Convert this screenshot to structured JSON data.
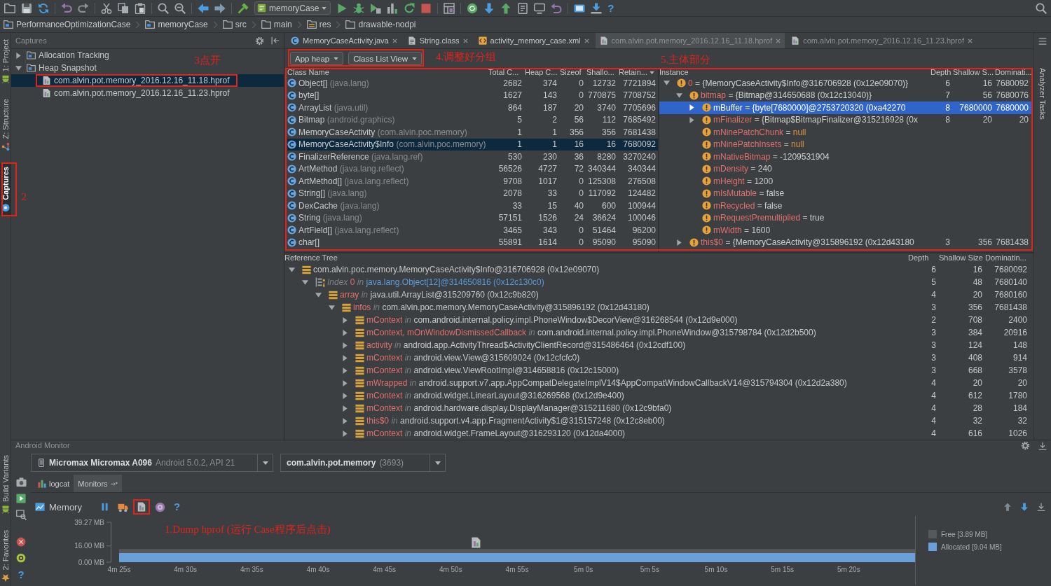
{
  "toolbar": {
    "run_configuration": "memoryCase",
    "help": "?"
  },
  "breadcrumbs": [
    {
      "label": "PerformanceOptimizationCase",
      "kind": "module"
    },
    {
      "label": "memoryCase",
      "kind": "module"
    },
    {
      "label": "src",
      "kind": "folder"
    },
    {
      "label": "main",
      "kind": "folder"
    },
    {
      "label": "res",
      "kind": "resources"
    },
    {
      "label": "drawable-nodpi",
      "kind": "folder"
    }
  ],
  "left_toolstrip": {
    "top": [
      {
        "label": "1: Project",
        "selected": false
      },
      {
        "label": "Z: Structure",
        "selected": false
      },
      {
        "label": "Captures",
        "selected": true,
        "callout": "2"
      }
    ],
    "bottom": [
      {
        "label": "Build Variants",
        "selected": false
      },
      {
        "label": "2: Favorites",
        "selected": false
      }
    ]
  },
  "right_toolstrip": [
    {
      "label": "Analyzer Tasks",
      "selected": false
    }
  ],
  "captures": {
    "title": "Captures",
    "tree": [
      {
        "label": "Allocation Tracking",
        "kind": "folder",
        "expanded": false,
        "selected": false
      },
      {
        "label": "Heap Snapshot",
        "kind": "folder",
        "expanded": true,
        "selected": false,
        "children": [
          {
            "label": "com.alvin.pot.memory_2016.12.16_11.18.hprof",
            "kind": "hprof",
            "selected": true,
            "callout": "3点开"
          },
          {
            "label": "com.alvin.pot.memory_2016.12.16_11.23.hprof",
            "kind": "hprof",
            "selected": false
          }
        ]
      }
    ]
  },
  "editor_tabs": [
    {
      "label": "MemoryCaseActivity.java",
      "kind": "class",
      "selected": false,
      "dimmed": false
    },
    {
      "label": "String.class",
      "kind": "classfile",
      "selected": false,
      "dimmed": false
    },
    {
      "label": "activity_memory_case.xml",
      "kind": "xml",
      "selected": false,
      "dimmed": false
    },
    {
      "label": "com.alvin.pot.memory_2016.12.16_11.18.hprof",
      "kind": "hprof",
      "selected": true,
      "dimmed": true
    },
    {
      "label": "com.alvin.pot.memory_2016.12.16_11.23.hprof",
      "kind": "hprof",
      "selected": false,
      "dimmed": true
    }
  ],
  "heap_view": {
    "heap": "App heap",
    "view": "Class List View",
    "callout": "4.调整好分组",
    "tables_callout": "5.主体部分",
    "class_table": {
      "columns": [
        {
          "label": "Class Name",
          "sorted": false
        },
        {
          "label": "Total C...",
          "sorted": false
        },
        {
          "label": "Heap C...",
          "sorted": false
        },
        {
          "label": "Sizeof",
          "sorted": false
        },
        {
          "label": "Shallo...",
          "sorted": false
        },
        {
          "label": "Retain...",
          "sorted": true
        }
      ],
      "rows": [
        {
          "name": "Object[]",
          "package": "(java.lang)",
          "total": "2682",
          "heap": "374",
          "sizeof": "0",
          "shallow": "12732",
          "retained": "7721894",
          "selected": false
        },
        {
          "name": "byte[]",
          "total": "1627",
          "heap": "143",
          "sizeof": "0",
          "shallow": "770875",
          "retained": "7708752",
          "selected": false
        },
        {
          "name": "ArrayList",
          "package": "(java.util)",
          "total": "864",
          "heap": "187",
          "sizeof": "20",
          "shallow": "3740",
          "retained": "7705696",
          "selected": false
        },
        {
          "name": "Bitmap",
          "package": "(android.graphics)",
          "total": "5",
          "heap": "2",
          "sizeof": "56",
          "shallow": "112",
          "retained": "7685492",
          "selected": false
        },
        {
          "name": "MemoryCaseActivity",
          "package": "(com.alvin.poc.memory)",
          "total": "1",
          "heap": "1",
          "sizeof": "356",
          "shallow": "356",
          "retained": "7681438",
          "selected": false
        },
        {
          "name": "MemoryCaseActivity$Info",
          "package": "(com.alvin.poc.memory)",
          "total": "1",
          "heap": "1",
          "sizeof": "16",
          "shallow": "16",
          "retained": "7680092",
          "selected": true
        },
        {
          "name": "FinalizerReference",
          "package": "(java.lang.ref)",
          "total": "530",
          "heap": "230",
          "sizeof": "36",
          "shallow": "8280",
          "retained": "3270240",
          "selected": false
        },
        {
          "name": "ArtMethod",
          "package": "(java.lang.reflect)",
          "total": "56526",
          "heap": "4727",
          "sizeof": "72",
          "shallow": "340344",
          "retained": "340344",
          "selected": false
        },
        {
          "name": "ArtMethod[]",
          "package": "(java.lang.reflect)",
          "total": "9708",
          "heap": "1017",
          "sizeof": "0",
          "shallow": "125308",
          "retained": "276508",
          "selected": false
        },
        {
          "name": "String[]",
          "package": "(java.lang)",
          "total": "2078",
          "heap": "33",
          "sizeof": "0",
          "shallow": "117092",
          "retained": "124482",
          "selected": false
        },
        {
          "name": "DexCache",
          "package": "(java.lang)",
          "total": "33",
          "heap": "15",
          "sizeof": "40",
          "shallow": "600",
          "retained": "100944",
          "selected": false
        },
        {
          "name": "String",
          "package": "(java.lang)",
          "total": "57151",
          "heap": "1526",
          "sizeof": "24",
          "shallow": "36624",
          "retained": "100046",
          "selected": false
        },
        {
          "name": "ArtField[]",
          "package": "(java.lang.reflect)",
          "total": "3465",
          "heap": "343",
          "sizeof": "0",
          "shallow": "51464",
          "retained": "96200",
          "selected": false
        },
        {
          "name": "char[]",
          "total": "55891",
          "heap": "1614",
          "sizeof": "0",
          "shallow": "95090",
          "retained": "95090",
          "selected": false
        }
      ]
    },
    "instances": {
      "columns": [
        "Instance",
        "Depth",
        "Shallow S...",
        "Dominati..."
      ],
      "tree": [
        {
          "name": "0",
          "assign": "=",
          "value": "{MemoryCaseActivity$Info@316706928 (0x12e09070)}",
          "kind": "value",
          "depth": "6",
          "shallow": "16",
          "dominating": "7680092",
          "expanded": true,
          "selected": false,
          "children": [
            {
              "name": "bitmap",
              "assign": "=",
              "value": "{Bitmap@314650688 (0x12c13040)}",
              "kind": "value",
              "depth": "7",
              "shallow": "56",
              "dominating": "7680076",
              "expanded": true,
              "selected": false,
              "children": [
                {
                  "name": "mBuffer",
                  "assign": "=",
                  "value": "{byte[7680000]@2753720320 (0xa42270",
                  "kind": "value",
                  "depth": "8",
                  "shallow": "7680000",
                  "dominating": "7680000",
                  "expanded": false,
                  "selected": true
                },
                {
                  "name": "mFinalizer",
                  "assign": "=",
                  "value": "{Bitmap$BitmapFinalizer@315216928 (0x",
                  "kind": "value",
                  "depth": "8",
                  "shallow": "20",
                  "dominating": "20",
                  "expanded": false,
                  "selected": false
                },
                {
                  "name": "mNinePatchChunk",
                  "assign": "=",
                  "value": "null",
                  "kind": "null",
                  "selected": false
                },
                {
                  "name": "mNinePatchInsets",
                  "assign": "=",
                  "value": "null",
                  "kind": "null",
                  "selected": false
                },
                {
                  "name": "mNativeBitmap",
                  "assign": "=",
                  "value": "-1209531904",
                  "kind": "value",
                  "selected": false
                },
                {
                  "name": "mDensity",
                  "assign": "=",
                  "value": "240",
                  "kind": "value",
                  "selected": false
                },
                {
                  "name": "mHeight",
                  "assign": "=",
                  "value": "1200",
                  "kind": "value",
                  "selected": false
                },
                {
                  "name": "mIsMutable",
                  "assign": "=",
                  "value": "false",
                  "kind": "value",
                  "selected": false
                },
                {
                  "name": "mRecycled",
                  "assign": "=",
                  "value": "false",
                  "kind": "value",
                  "selected": false
                },
                {
                  "name": "mRequestPremultiplied",
                  "assign": "=",
                  "value": "true",
                  "kind": "value",
                  "selected": false
                },
                {
                  "name": "mWidth",
                  "assign": "=",
                  "value": "1600",
                  "kind": "value",
                  "selected": false
                }
              ]
            },
            {
              "name": "this$0",
              "assign": "=",
              "value": "{MemoryCaseActivity@315896192 (0x12d43180",
              "kind": "value",
              "depth": "3",
              "shallow": "356",
              "dominating": "7681438",
              "expanded": false,
              "selected": false
            }
          ]
        }
      ]
    },
    "reference_tree": {
      "columns": [
        "Reference Tree",
        "Depth",
        "Shallow Size",
        "Dominatin..."
      ],
      "tree": [
        {
          "kind": "root",
          "object": "com.alvin.poc.memory.MemoryCaseActivity$Info@316706928 (0x12e09070)",
          "depth": "6",
          "shallow": "16",
          "dominating": "7680092",
          "expanded": true,
          "selected": false,
          "children": [
            {
              "kind": "index",
              "index_label": "Index",
              "field": "0",
              "relation": "in",
              "object": "java.lang.Object[12]@314650816 (0x12c130c0)",
              "depth": "5",
              "shallow": "48",
              "dominating": "7680140",
              "expanded": true,
              "selected": false,
              "children": [
                {
                  "kind": "field",
                  "field": "array",
                  "relation": "in",
                  "object": "java.util.ArrayList@315209760 (0x12c9b820)",
                  "depth": "4",
                  "shallow": "20",
                  "dominating": "7680160",
                  "expanded": true,
                  "selected": false,
                  "children": [
                    {
                      "kind": "field",
                      "field": "infos",
                      "relation": "in",
                      "object": "com.alvin.poc.memory.MemoryCaseActivity@315896192 (0x12d43180)",
                      "depth": "3",
                      "shallow": "356",
                      "dominating": "7681438",
                      "expanded": true,
                      "selected": false,
                      "children": [
                        {
                          "kind": "field",
                          "field": "mContext",
                          "relation": "in",
                          "object": "com.android.internal.policy.impl.PhoneWindow$DecorView@316268544 (0x12d9e000)",
                          "depth": "2",
                          "shallow": "708",
                          "dominating": "2400",
                          "expanded": false,
                          "selected": false
                        },
                        {
                          "kind": "field",
                          "field": "mContext, mOnWindowDismissedCallback",
                          "relation": "in",
                          "object": "com.android.internal.policy.impl.PhoneWindow@315798784 (0x12d2b500)",
                          "depth": "3",
                          "shallow": "384",
                          "dominating": "20916",
                          "expanded": false,
                          "selected": false
                        },
                        {
                          "kind": "field",
                          "field": "activity",
                          "relation": "in",
                          "object": "android.app.ActivityThread$ActivityClientRecord@315486464 (0x12cdf100)",
                          "depth": "3",
                          "shallow": "124",
                          "dominating": "148",
                          "expanded": false,
                          "selected": false
                        },
                        {
                          "kind": "field",
                          "field": "mContext",
                          "relation": "in",
                          "object": "android.view.View@315609024 (0x12cfcfc0)",
                          "depth": "3",
                          "shallow": "408",
                          "dominating": "914",
                          "expanded": false,
                          "selected": false
                        },
                        {
                          "kind": "field",
                          "field": "mContext",
                          "relation": "in",
                          "object": "android.view.ViewRootImpl@314658816 (0x12c15000)",
                          "depth": "3",
                          "shallow": "668",
                          "dominating": "3578",
                          "expanded": false,
                          "selected": false
                        },
                        {
                          "kind": "field",
                          "field": "mWrapped",
                          "relation": "in",
                          "object": "android.support.v7.app.AppCompatDelegateImplV14$AppCompatWindowCallbackV14@315794304 (0x12d2a380)",
                          "depth": "4",
                          "shallow": "20",
                          "dominating": "20",
                          "expanded": false,
                          "selected": false
                        },
                        {
                          "kind": "field",
                          "field": "mContext",
                          "relation": "in",
                          "object": "android.widget.LinearLayout@316269568 (0x12d9e400)",
                          "depth": "4",
                          "shallow": "612",
                          "dominating": "1780",
                          "expanded": false,
                          "selected": false
                        },
                        {
                          "kind": "field",
                          "field": "mContext",
                          "relation": "in",
                          "object": "android.hardware.display.DisplayManager@315211680 (0x12c9bfa0)",
                          "depth": "4",
                          "shallow": "28",
                          "dominating": "184",
                          "expanded": false,
                          "selected": false
                        },
                        {
                          "kind": "field",
                          "field": "this$0",
                          "relation": "in",
                          "object": "android.support.v4.app.FragmentActivity$1@315157248 (0x12c8eb00)",
                          "depth": "4",
                          "shallow": "32",
                          "dominating": "32",
                          "expanded": false,
                          "selected": false
                        },
                        {
                          "kind": "field",
                          "field": "mContext",
                          "relation": "in",
                          "object": "android.widget.FrameLayout@316293120 (0x12da4000)",
                          "depth": "4",
                          "shallow": "616",
                          "dominating": "1026",
                          "expanded": false,
                          "selected": false
                        }
                      ]
                    }
                  ]
                }
              ]
            }
          ]
        }
      ]
    }
  },
  "monitor": {
    "title": "Android Monitor",
    "device": {
      "name": "Micromax Micromax A096",
      "detail": "Android 5.0.2, API 21"
    },
    "process": {
      "name": "com.alvin.pot.memory",
      "detail": "(3693)"
    },
    "tabs": [
      {
        "label": "logcat",
        "selected": false
      },
      {
        "label": "Monitors",
        "selected": true
      }
    ],
    "side_help": "?",
    "memory": {
      "title": "Memory",
      "help": "?",
      "dump_callout": "1.Dump hprof (运行 Case程序后点击)",
      "chart_data": {
        "type": "area",
        "stacked": true,
        "legend": "right",
        "categories": [
          "4m 25s",
          "4m 30s",
          "4m 35s",
          "4m 40s",
          "4m 45s",
          "4m 50s",
          "4m 55s",
          "5m 0s",
          "5m 5s",
          "5m 10s",
          "5m 15s",
          "5m 20s",
          null
        ],
        "ylim": [
          0,
          39.27
        ],
        "yticks": [
          {
            "value": 0,
            "label": "0.00 MB"
          },
          {
            "value": 16,
            "label": "16.00 MB"
          },
          {
            "value": 39.27,
            "label": "39.27 MB"
          }
        ],
        "series": [
          {
            "name": "Allocated [9.04 MB]",
            "color": "#6a9fd8",
            "values": [
              9.04,
              9.04,
              9.04,
              9.04,
              9.04,
              9.04,
              9.04,
              9.04,
              9.04,
              9.04,
              9.04,
              9.04,
              9.04
            ]
          },
          {
            "name": "Free [3.89 MB]",
            "color": "#55595c",
            "values": [
              3.89,
              3.89,
              3.89,
              3.89,
              3.89,
              3.89,
              3.89,
              3.89,
              3.89,
              3.89,
              3.89,
              3.89,
              3.89
            ]
          }
        ]
      }
    }
  }
}
